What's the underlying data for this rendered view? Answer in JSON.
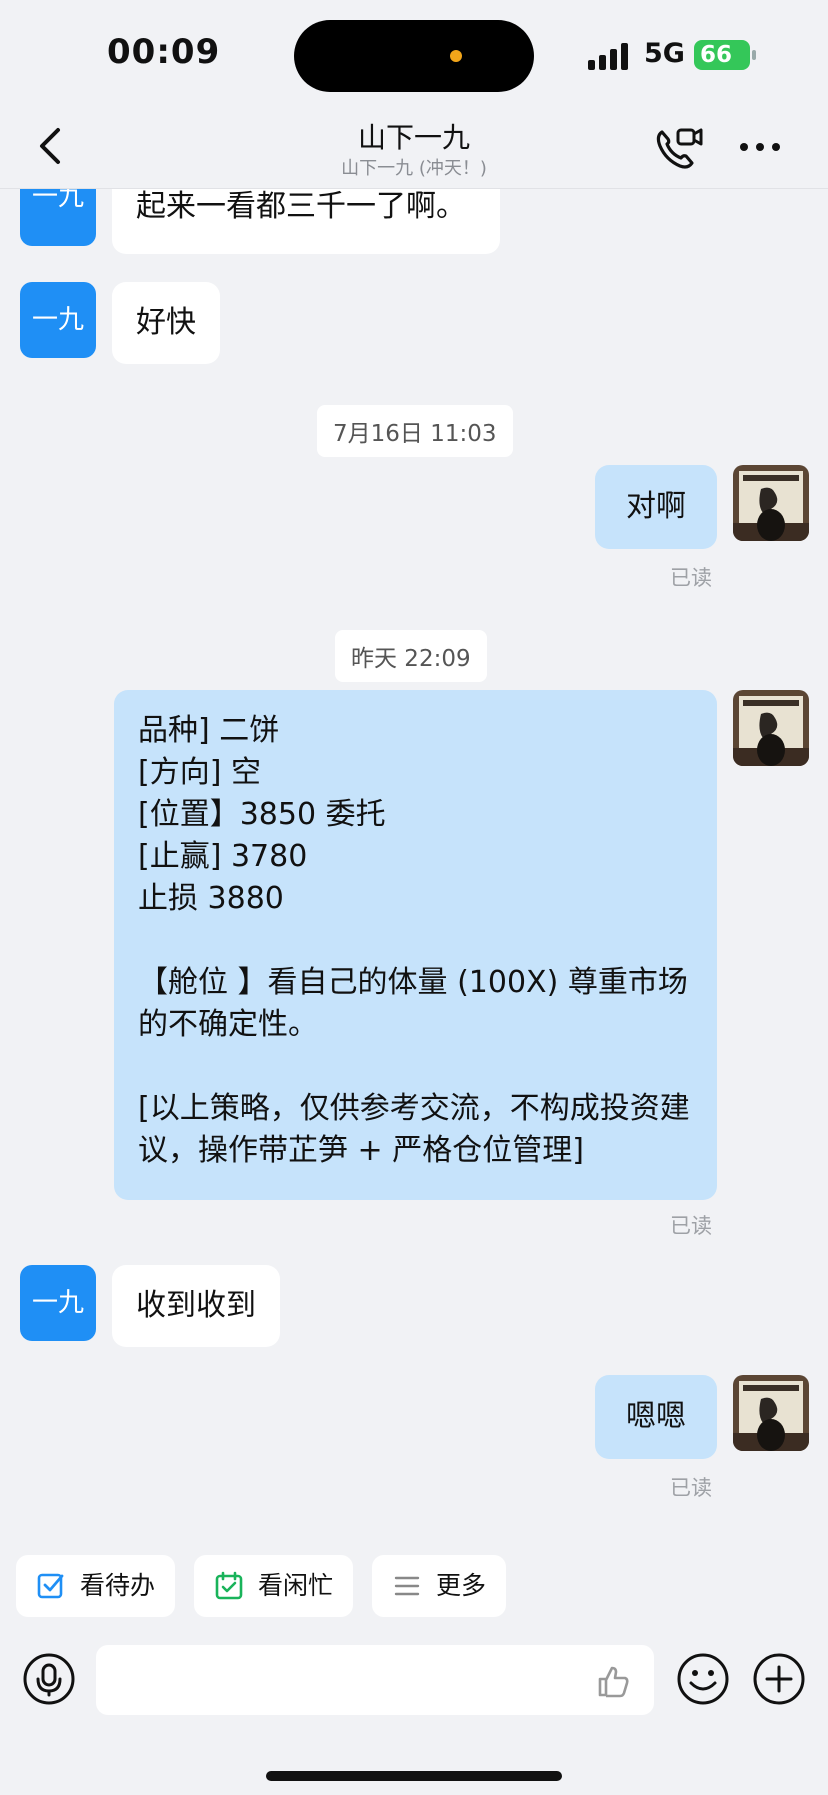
{
  "status_bar": {
    "time": "00:09",
    "network": "5G",
    "battery": "66"
  },
  "header": {
    "title": "山下一九",
    "subtitle": "山下一九 (冲天！)"
  },
  "contact_avatar_text": "一九",
  "messages": {
    "m1": "起来一看都三千一了啊。",
    "m2": "好快",
    "t1": "7月16日 11:03",
    "m3": "对啊",
    "r1": "已读",
    "t2": "昨天 22:09",
    "m4": "品种] 二饼\n[方向] 空\n[位置】3850 委托\n[止赢] 3780\n止损 3880\n\n【舱位 】看自己的体量 (100X) 尊重市场的不确定性。\n\n[以上策略，仅供参考交流，不构成投资建议，操作带芷笋 + 严格仓位管理]",
    "r2": "已读",
    "m5": "收到收到",
    "m6": "嗯嗯",
    "r3": "已读"
  },
  "quick_actions": {
    "todo": "看待办",
    "busy": "看闲忙",
    "more": "更多"
  },
  "colors": {
    "accent": "#1f8ff5",
    "outgoing_bubble": "#c6e3fb",
    "background": "#f1f2f5"
  }
}
